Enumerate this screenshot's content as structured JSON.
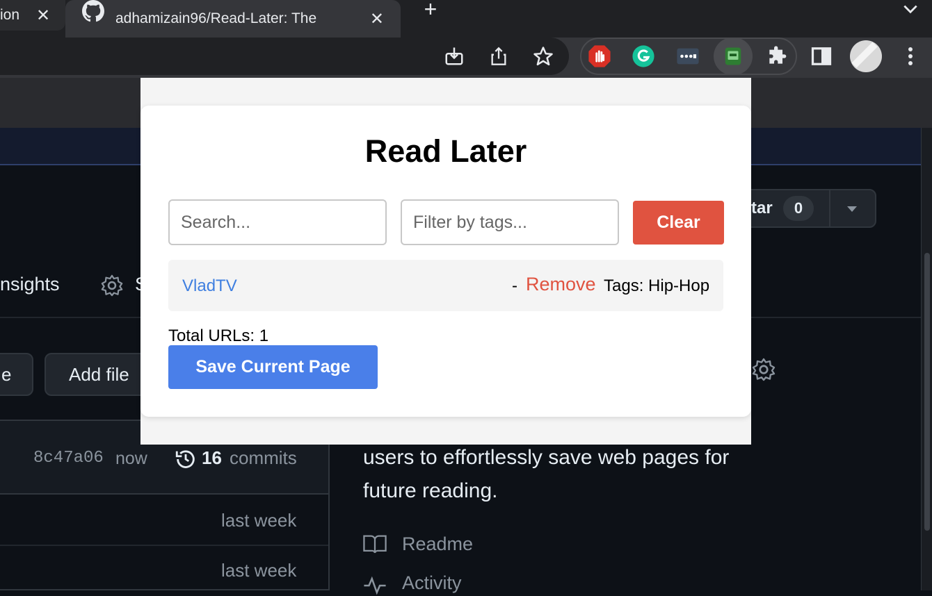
{
  "browser": {
    "tabs": [
      {
        "label": "ion",
        "active": false
      },
      {
        "label": "adhamizain96/Read-Later: The",
        "active": true
      }
    ],
    "close_glyph": "✕",
    "new_tab_glyph": "+",
    "toolbar_icons": [
      "install-icon",
      "share-icon",
      "bookmark-star-icon"
    ],
    "extension_icons": [
      "adblock-icon",
      "grammarly-icon",
      "dots-extension-icon",
      "read-later-extension-icon",
      "puzzle-extensions-icon",
      "side-panel-icon",
      "profile-avatar-icon",
      "kebab-menu-icon"
    ]
  },
  "background_page": {
    "star_label": "tar",
    "star_count": "0",
    "insights_label": "nsights",
    "settings_partial": "S",
    "edit_btn_partial": "e",
    "add_file_label": "Add file",
    "commit_hash": "8c47a06",
    "commit_time": "now",
    "commits_count": "16",
    "commits_label": "commits",
    "description_line1": "users to effortlessly save web pages for",
    "description_line2": "future reading.",
    "row1_time": "last week",
    "row2_time": "last week",
    "readme_label": "Readme",
    "activity_label": "Activity"
  },
  "popup": {
    "title": "Read Later",
    "search_placeholder": "Search...",
    "tags_placeholder": "Filter by tags...",
    "clear_label": "Clear",
    "items": [
      {
        "title": "VladTV",
        "separator": "-",
        "remove_label": "Remove",
        "tags_text": "Tags: Hip-Hop"
      }
    ],
    "total_text": "Total URLs: 1",
    "save_label": "Save Current Page",
    "colors": {
      "clear": "#e05340",
      "save": "#4a7fe9",
      "link": "#3f7fe0"
    }
  }
}
